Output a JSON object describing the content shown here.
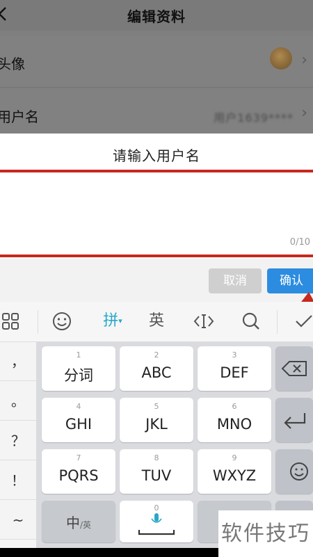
{
  "page": {
    "title": "编辑资料",
    "rows": [
      {
        "label": "头像"
      },
      {
        "label": "用户名",
        "value": "用户1639****"
      }
    ]
  },
  "dialog": {
    "title": "请输入用户名",
    "input_value": "",
    "counter": "0/10",
    "cancel_label": "取消",
    "confirm_label": "确认",
    "highlight_color": "#c8281e",
    "confirm_color": "#2b8ce0"
  },
  "keyboard": {
    "toolbar": {
      "menu_icon": "grid-icon",
      "emoji_icon": "smiley-icon",
      "pinyin_label": "拼",
      "english_label": "英",
      "cursor_icon": "cursor-icon",
      "search_icon": "search-icon",
      "collapse_icon": "check-icon",
      "active_color": "#28a8c8"
    },
    "side_keys": [
      "，",
      "。",
      "？",
      "！",
      "~"
    ],
    "keys": [
      {
        "num": "1",
        "label": "分词"
      },
      {
        "num": "2",
        "label": "ABC"
      },
      {
        "num": "3",
        "label": "DEF"
      },
      {
        "num": "4",
        "label": "GHI"
      },
      {
        "num": "5",
        "label": "JKL"
      },
      {
        "num": "6",
        "label": "MNO"
      },
      {
        "num": "7",
        "label": "PQRS"
      },
      {
        "num": "8",
        "label": "TUV"
      },
      {
        "num": "9",
        "label": "WXYZ"
      }
    ],
    "bottom": {
      "lang_main": "中",
      "lang_sub": "/英",
      "space_num": "0"
    },
    "function_keys": [
      "backspace-icon",
      "enter-icon",
      "emoji-key-icon"
    ]
  },
  "watermark": "软件技巧"
}
